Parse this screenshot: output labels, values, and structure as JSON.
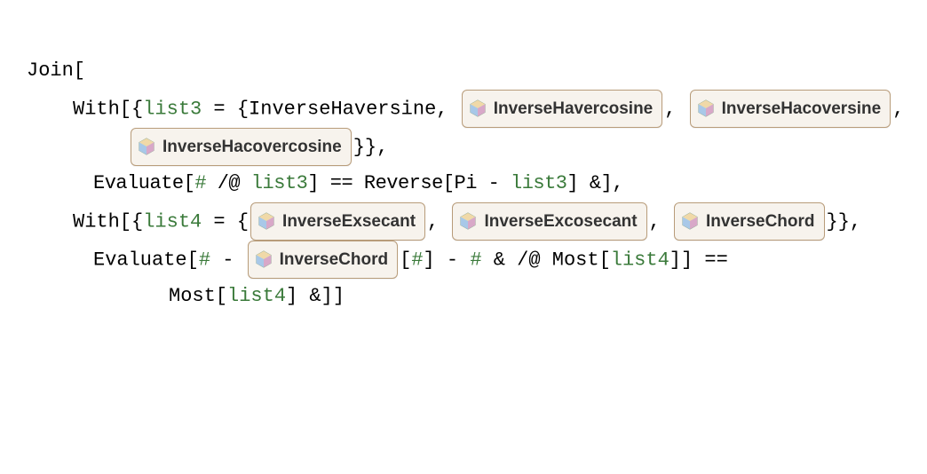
{
  "lines": {
    "l1_text": "Join[",
    "l2_pre": "With[{",
    "l2_var": "list3",
    "l2_mid": " = {InverseHaversine, ",
    "l2_post": ", ",
    "l3_post": "}},",
    "l4_pre": "Evaluate[",
    "l4_s1": "#",
    "l4_m1": " /@ ",
    "l4_v1": "list3",
    "l4_m2": "] == Reverse[Pi - ",
    "l4_v2": "list3",
    "l4_m3": "] &],",
    "l5_pre": "With[{",
    "l5_var": "list4",
    "l5_mid": " = {",
    "l5_sep": ", ",
    "l5_post": "}},",
    "l6_pre": "Evaluate[",
    "l6_s1": "#",
    "l6_m1": " - ",
    "l6_m2": "[",
    "l6_s2": "#",
    "l6_m3": "] - ",
    "l6_s3": "#",
    "l6_m4": " & /@ Most[",
    "l6_v1": "list4",
    "l6_m5": "]] ==",
    "l7_m1": "Most[",
    "l7_v1": "list4",
    "l7_m2": "] &]]"
  },
  "resources": {
    "r1": "InverseHavercosine",
    "r2": "InverseHacoversine",
    "r3": "InverseHacovercosine",
    "r4": "InverseExsecant",
    "r5": "InverseExcosecant",
    "r6": "InverseChord",
    "r7": "InverseChord"
  }
}
